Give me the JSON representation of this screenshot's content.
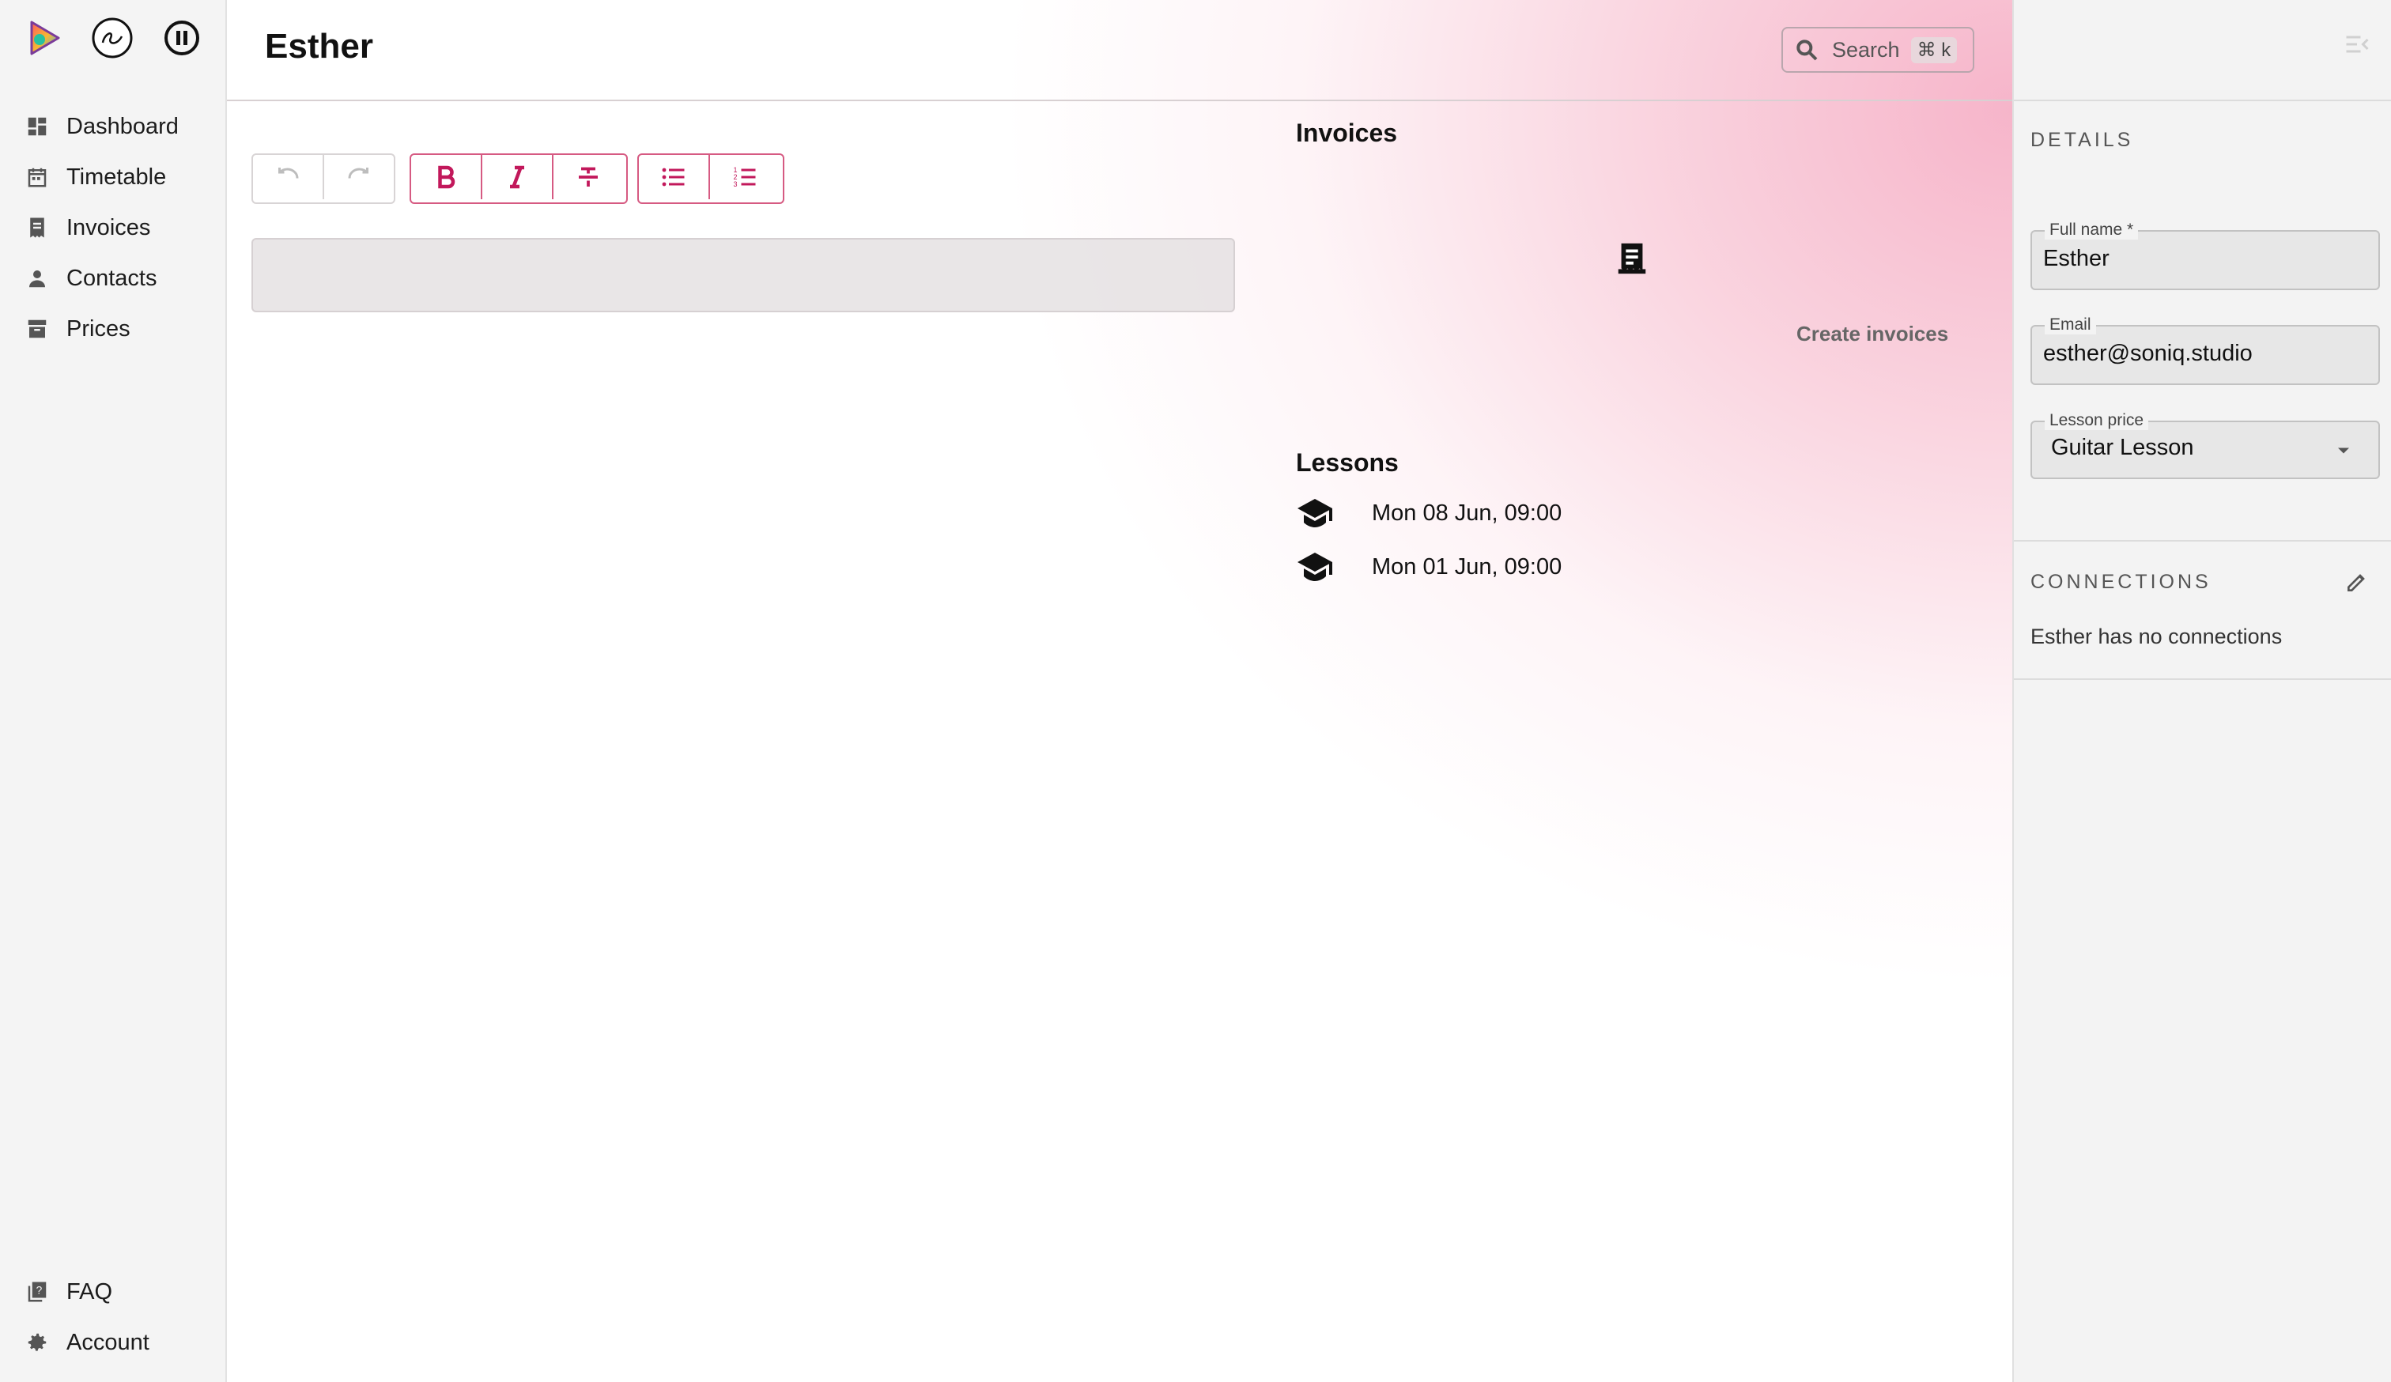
{
  "sidebar": {
    "logos": [
      "app-logo",
      "soni-logo",
      "pause-icon"
    ],
    "nav": [
      {
        "label": "Dashboard",
        "icon": "dashboard-icon"
      },
      {
        "label": "Timetable",
        "icon": "calendar-icon"
      },
      {
        "label": "Invoices",
        "icon": "invoice-icon"
      },
      {
        "label": "Contacts",
        "icon": "person-icon"
      },
      {
        "label": "Prices",
        "icon": "archive-icon"
      }
    ],
    "bottom": [
      {
        "label": "FAQ",
        "icon": "faq-icon"
      },
      {
        "label": "Account",
        "icon": "gear-icon"
      }
    ]
  },
  "header": {
    "title": "Esther",
    "search_label": "Search",
    "search_shortcut": "⌘ k"
  },
  "toolbar": {
    "undo": "undo-icon",
    "redo": "redo-icon",
    "bold": "bold-icon",
    "italic": "italic-icon",
    "strike": "strikethrough-icon",
    "bullet_list": "bullet-list-icon",
    "numbered_list": "numbered-list-icon"
  },
  "invoices": {
    "heading": "Invoices",
    "create_label": "Create invoices"
  },
  "lessons": {
    "heading": "Lessons",
    "items": [
      "Mon 08 Jun, 09:00",
      "Mon 01 Jun, 09:00"
    ]
  },
  "details": {
    "heading": "DETAILS",
    "full_name_label": "Full name *",
    "full_name_value": "Esther",
    "email_label": "Email",
    "email_value": "esther@soniq.studio",
    "lesson_price_label": "Lesson price",
    "lesson_price_value": "Guitar Lesson"
  },
  "connections": {
    "heading": "CONNECTIONS",
    "empty_text": "Esther has no connections"
  },
  "colors": {
    "accent": "#c2185b",
    "accent_border": "#d65a82",
    "gradient_pink": "#f4a0bb"
  }
}
